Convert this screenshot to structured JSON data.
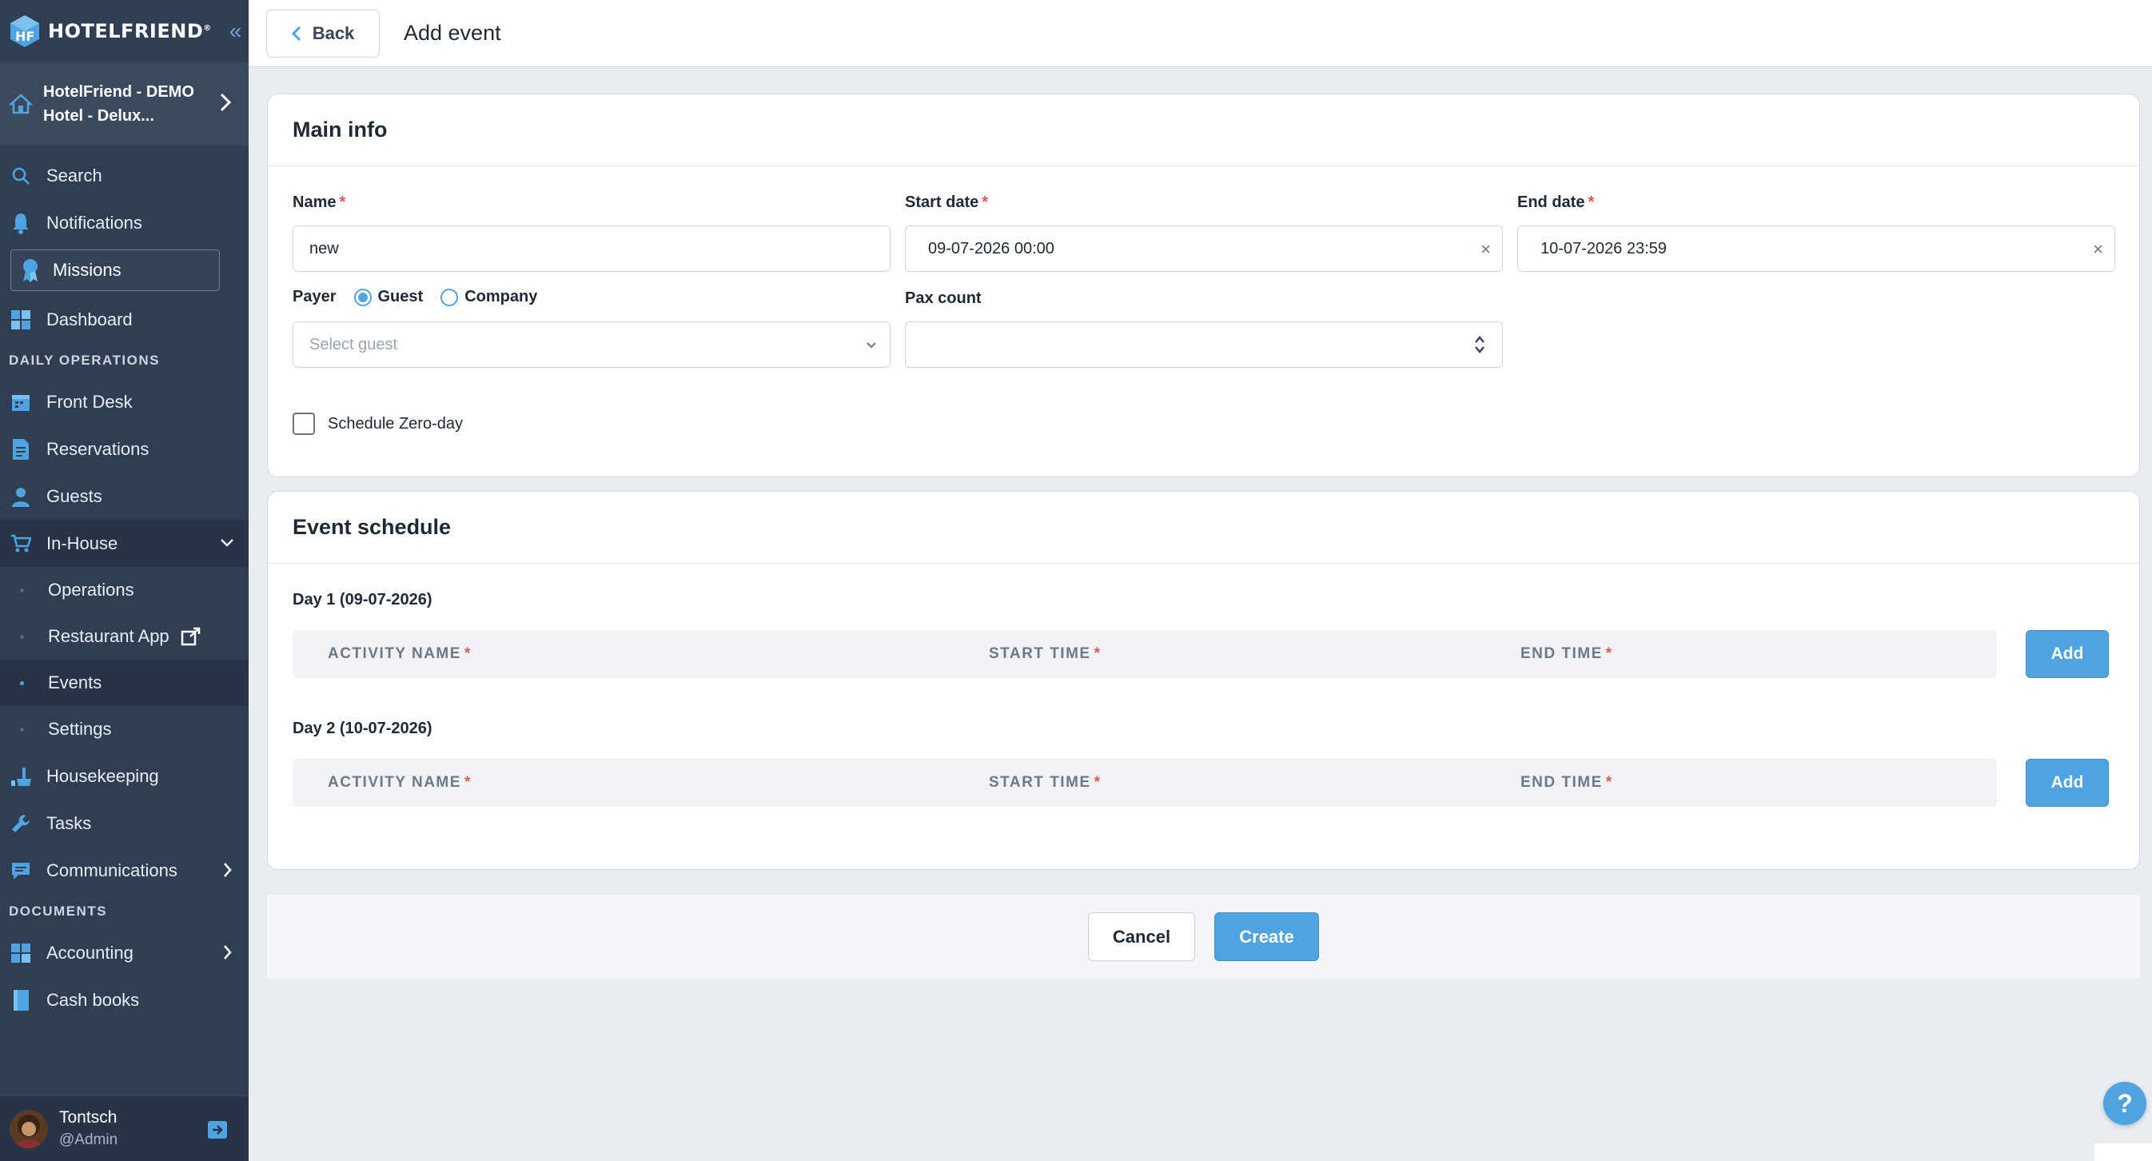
{
  "brand": {
    "name": "HOTELFRIEND",
    "trademark": "®"
  },
  "hotel": {
    "line1": "HotelFriend - DEMO",
    "line2": "Hotel - Delux..."
  },
  "nav": {
    "search": "Search",
    "notifications": "Notifications",
    "missions": "Missions",
    "dashboard": "Dashboard",
    "section_daily": "DAILY OPERATIONS",
    "front_desk": "Front Desk",
    "reservations": "Reservations",
    "guests": "Guests",
    "in_house": "In-House",
    "operations": "Operations",
    "restaurant_app": "Restaurant App",
    "events": "Events",
    "settings": "Settings",
    "housekeeping": "Housekeeping",
    "tasks": "Tasks",
    "communications": "Communications",
    "section_documents": "DOCUMENTS",
    "accounting": "Accounting",
    "cash_books": "Cash books"
  },
  "user": {
    "name": "Tontsch",
    "role": "@Admin"
  },
  "header": {
    "back_label": "Back",
    "title": "Add event"
  },
  "main_info": {
    "title": "Main info",
    "name_label": "Name",
    "name_value": "new",
    "start_label": "Start date",
    "start_value": "09-07-2026 00:00",
    "end_label": "End date",
    "end_value": "10-07-2026 23:59",
    "payer_label": "Payer",
    "payer_options": [
      "Guest",
      "Company"
    ],
    "payer_selected": "Guest",
    "guest_placeholder": "Select guest",
    "pax_label": "Pax count",
    "pax_value": "",
    "zero_day_label": "Schedule Zero-day",
    "zero_day_checked": false,
    "required_mark": "*",
    "clear_symbol": "×"
  },
  "schedule": {
    "title": "Event schedule",
    "columns": [
      "ACTIVITY NAME",
      "START TIME",
      "END TIME"
    ],
    "add_label": "Add",
    "days": [
      {
        "label": "Day 1 (09-07-2026)"
      },
      {
        "label": "Day 2 (10-07-2026)"
      }
    ]
  },
  "actions": {
    "cancel": "Cancel",
    "create": "Create"
  },
  "help": {
    "label": "?"
  },
  "colors": {
    "accent": "#4fa3e0",
    "sidebar": "#2f3e52",
    "required": "#e25757"
  }
}
